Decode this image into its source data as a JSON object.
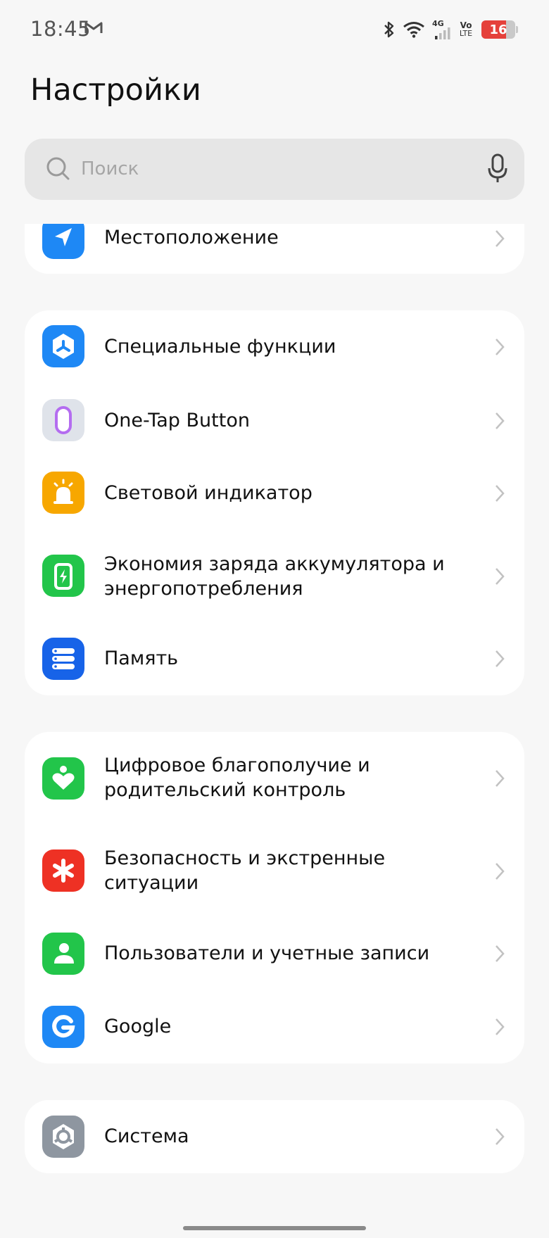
{
  "status_bar": {
    "time": "18:45",
    "notification_icon": "gmail-icon",
    "icons": [
      "bluetooth-icon",
      "wifi-icon",
      "signal-4g-icon",
      "volte-icon"
    ],
    "net_label": "4G",
    "volte_top": "Vo",
    "volte_bottom": "LTE",
    "battery_level": "16",
    "battery_color": "#e5413b"
  },
  "page": {
    "title": "Настройки"
  },
  "search": {
    "placeholder": "Поиск"
  },
  "groups": [
    {
      "items": [
        {
          "label": "Местоположение",
          "icon": "location-icon",
          "color": "#1e88f5"
        }
      ]
    },
    {
      "items": [
        {
          "label": "Специальные функции",
          "icon": "accessibility-icon",
          "color": "#1e88f5"
        },
        {
          "label": "One-Tap Button",
          "icon": "one-tap-button-icon",
          "color": "#d9dde3"
        },
        {
          "label": "Световой индикатор",
          "icon": "light-indicator-icon",
          "color": "#f7a700"
        },
        {
          "label": "Экономия заряда аккумулятора и энергопотребления",
          "icon": "battery-saver-icon",
          "color": "#22c54a"
        },
        {
          "label": "Память",
          "icon": "storage-icon",
          "color": "#1763e8"
        }
      ]
    },
    {
      "items": [
        {
          "label": "Цифровое благополучие и родительский контроль",
          "icon": "digital-wellbeing-icon",
          "color": "#22c54a"
        },
        {
          "label": "Безопасность и экстренные ситуации",
          "icon": "safety-emergency-icon",
          "color": "#ee3124"
        },
        {
          "label": "Пользователи и учетные записи",
          "icon": "users-accounts-icon",
          "color": "#22c54a"
        },
        {
          "label": "Google",
          "icon": "google-icon",
          "color": "#1e88f5"
        }
      ]
    },
    {
      "items": [
        {
          "label": "Система",
          "icon": "system-icon",
          "color": "#8e96a0"
        }
      ]
    }
  ]
}
